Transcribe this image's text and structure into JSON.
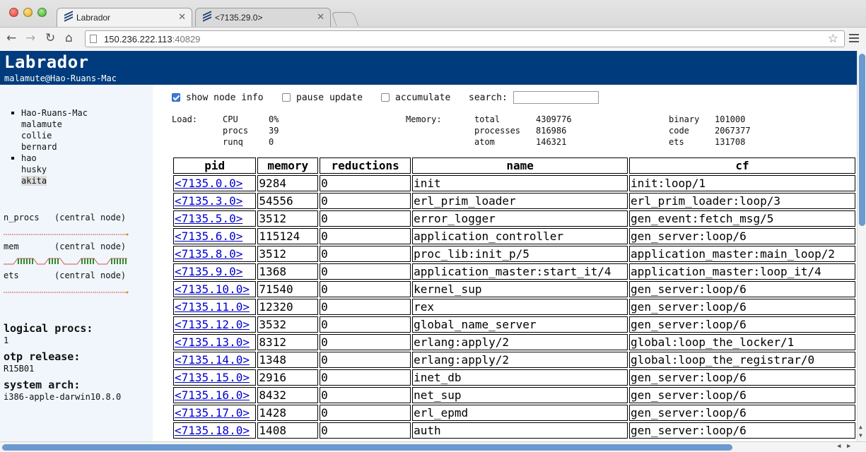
{
  "browser": {
    "tabs": [
      {
        "title": "Labrador",
        "active": true
      },
      {
        "title": "<7135.29.0>",
        "active": false
      }
    ],
    "url_host": "150.236.222.113",
    "url_port": ":40829",
    "icons": {
      "back": "back-arrow-icon",
      "forward": "forward-arrow-icon",
      "reload": "reload-icon",
      "home": "home-icon",
      "bookmark": "star-icon",
      "menu": "menu-icon"
    }
  },
  "header": {
    "title": "Labrador",
    "subtitle": "malamute@Hao-Ruans-Mac"
  },
  "sidebar": {
    "nodes": [
      {
        "label": "Hao-Ruans-Mac",
        "bullet": true
      },
      {
        "label": "malamute",
        "bullet": false
      },
      {
        "label": "collie",
        "bullet": false
      },
      {
        "label": "bernard",
        "bullet": false
      },
      {
        "label": "hao",
        "bullet": true
      },
      {
        "label": "husky",
        "bullet": false
      },
      {
        "label": "akita",
        "bullet": false,
        "selected": true
      }
    ],
    "metrics": [
      {
        "name": "n_procs",
        "central": "(central node)"
      },
      {
        "name": "mem",
        "central": "(central node)"
      },
      {
        "name": "ets",
        "central": "(central node)"
      }
    ],
    "info": [
      {
        "label": "logical procs:",
        "value": "1"
      },
      {
        "label": "otp release:",
        "value": "R15B01"
      },
      {
        "label": "system arch:",
        "value": "i386-apple-darwin10.8.0"
      }
    ]
  },
  "controls": {
    "show_node_info": {
      "label": "show node info",
      "checked": true
    },
    "pause_update": {
      "label": "pause update",
      "checked": false
    },
    "accumulate": {
      "label": "accumulate",
      "checked": false
    },
    "search_label": "search:",
    "search_value": ""
  },
  "stats": {
    "load_label": "Load:",
    "load": [
      {
        "k": "CPU",
        "v": "0%"
      },
      {
        "k": "procs",
        "v": "39"
      },
      {
        "k": "runq",
        "v": "0"
      }
    ],
    "memory_label": "Memory:",
    "memory": [
      {
        "k": "total",
        "v": "4309776"
      },
      {
        "k": "processes",
        "v": "816986"
      },
      {
        "k": "atom",
        "v": "146321"
      }
    ],
    "memory2": [
      {
        "k": "binary",
        "v": "101000"
      },
      {
        "k": "code",
        "v": "2067377"
      },
      {
        "k": "ets",
        "v": "131708"
      }
    ]
  },
  "table": {
    "columns": [
      "pid",
      "memory",
      "reductions",
      "name",
      "cf"
    ],
    "rows": [
      [
        "<7135.0.0>",
        "9284",
        "0",
        "init",
        "init:loop/1"
      ],
      [
        "<7135.3.0>",
        "54556",
        "0",
        "erl_prim_loader",
        "erl_prim_loader:loop/3"
      ],
      [
        "<7135.5.0>",
        "3512",
        "0",
        "error_logger",
        "gen_event:fetch_msg/5"
      ],
      [
        "<7135.6.0>",
        "115124",
        "0",
        "application_controller",
        "gen_server:loop/6"
      ],
      [
        "<7135.8.0>",
        "3512",
        "0",
        "proc_lib:init_p/5",
        "application_master:main_loop/2"
      ],
      [
        "<7135.9.0>",
        "1368",
        "0",
        "application_master:start_it/4",
        "application_master:loop_it/4"
      ],
      [
        "<7135.10.0>",
        "71540",
        "0",
        "kernel_sup",
        "gen_server:loop/6"
      ],
      [
        "<7135.11.0>",
        "12320",
        "0",
        "rex",
        "gen_server:loop/6"
      ],
      [
        "<7135.12.0>",
        "3532",
        "0",
        "global_name_server",
        "gen_server:loop/6"
      ],
      [
        "<7135.13.0>",
        "8312",
        "0",
        "erlang:apply/2",
        "global:loop_the_locker/1"
      ],
      [
        "<7135.14.0>",
        "1348",
        "0",
        "erlang:apply/2",
        "global:loop_the_registrar/0"
      ],
      [
        "<7135.15.0>",
        "2916",
        "0",
        "inet_db",
        "gen_server:loop/6"
      ],
      [
        "<7135.16.0>",
        "8432",
        "0",
        "net_sup",
        "gen_server:loop/6"
      ],
      [
        "<7135.17.0>",
        "1428",
        "0",
        "erl_epmd",
        "gen_server:loop/6"
      ],
      [
        "<7135.18.0>",
        "1408",
        "0",
        "auth",
        "gen_server:loop/6"
      ]
    ]
  },
  "colors": {
    "header_bg": "#003c7d",
    "sidebar_bg": "#f0f6fb",
    "link": "#0000cc",
    "sparkline_red": "#d9534f",
    "sparkline_green": "#2e8b2e"
  }
}
